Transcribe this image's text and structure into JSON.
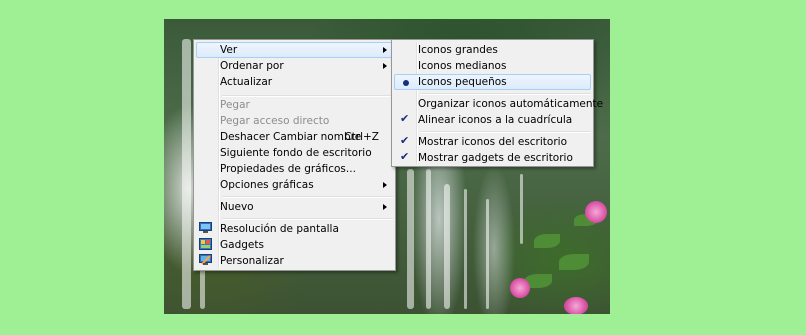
{
  "context_menu": {
    "items": [
      {
        "label": "Ver"
      },
      {
        "label": "Ordenar por"
      },
      {
        "label": "Actualizar"
      },
      {
        "label": "Pegar"
      },
      {
        "label": "Pegar acceso directo"
      },
      {
        "label": "Deshacer Cambiar nombre",
        "shortcut": "Ctrl+Z"
      },
      {
        "label": "Siguiente fondo de escritorio"
      },
      {
        "label": "Propiedades de gráficos..."
      },
      {
        "label": "Opciones gráficas"
      },
      {
        "label": "Nuevo"
      },
      {
        "label": "Resolución de pantalla"
      },
      {
        "label": "Gadgets"
      },
      {
        "label": "Personalizar"
      }
    ]
  },
  "view_submenu": {
    "items": [
      {
        "label": "Iconos grandes"
      },
      {
        "label": "Iconos medianos"
      },
      {
        "label": "Iconos pequeños",
        "selected": true
      },
      {
        "label": "Organizar iconos automáticamente"
      },
      {
        "label": "Alinear iconos a la cuadrícula",
        "checked": true
      },
      {
        "label": "Mostrar iconos del escritorio",
        "checked": true
      },
      {
        "label": "Mostrar gadgets de escritorio",
        "checked": true
      }
    ]
  },
  "colors": {
    "page_background": "#9fef94",
    "menu_background": "#f0f0f0",
    "highlight": "#dcebfc",
    "disabled_text": "#8d8d8d"
  }
}
